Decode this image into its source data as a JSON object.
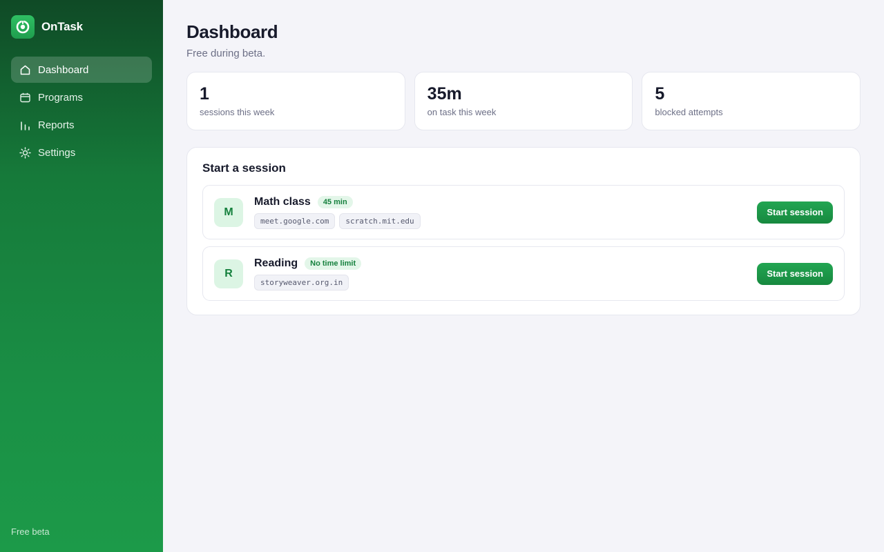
{
  "app": {
    "name": "OnTask",
    "logo_icon": "ontask-logo-icon"
  },
  "sidebar": {
    "items": [
      {
        "label": "Dashboard",
        "icon": "home-icon",
        "active": true
      },
      {
        "label": "Programs",
        "icon": "calendar-icon",
        "active": false
      },
      {
        "label": "Reports",
        "icon": "bar-chart-icon",
        "active": false
      },
      {
        "label": "Settings",
        "icon": "sun-gear-icon",
        "active": false
      }
    ],
    "footer": "Free beta"
  },
  "page": {
    "title": "Dashboard",
    "subtitle": "Free during beta."
  },
  "stats": [
    {
      "value": "1",
      "label": "sessions this week"
    },
    {
      "value": "35m",
      "label": "on task this week"
    },
    {
      "value": "5",
      "label": "blocked attempts"
    }
  ],
  "sessions": {
    "title": "Start a session",
    "programs": [
      {
        "initial": "M",
        "name": "Math class",
        "duration": "45 min",
        "domains": [
          "meet.google.com",
          "scratch.mit.edu"
        ],
        "button": "Start session"
      },
      {
        "initial": "R",
        "name": "Reading",
        "duration": "No time limit",
        "domains": [
          "storyweaver.org.in"
        ],
        "button": "Start session"
      }
    ]
  },
  "colors": {
    "brand_green": "#1c9a49",
    "sidebar_top": "#0f4a26",
    "accent_text": "#15803d",
    "page_bg": "#f4f4f9"
  }
}
